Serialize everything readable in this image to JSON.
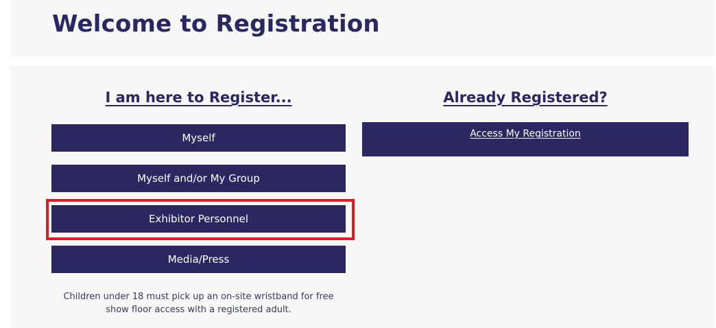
{
  "header": {
    "title": "Welcome to Registration"
  },
  "register": {
    "heading": "I am here to Register...",
    "buttons": {
      "myself": "Myself",
      "group": "Myself and/or My Group",
      "exhibitor": "Exhibitor Personnel",
      "media": "Media/Press"
    },
    "note": "Children under 18 must pick up an on-site wristband for free show floor access with a registered adult."
  },
  "already": {
    "heading": "Already Registered?",
    "access_label": "Access My Registration"
  },
  "colors": {
    "brand_navy": "#2b2861",
    "highlight_red": "#e01b22",
    "card_bg": "#f7f7f8"
  }
}
